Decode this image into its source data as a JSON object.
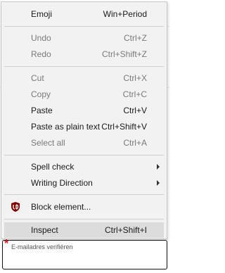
{
  "context_menu": {
    "items": [
      {
        "label": "Emoji",
        "shortcut": "Win+Period",
        "enabled": true
      },
      {
        "label": "Undo",
        "shortcut": "Ctrl+Z",
        "enabled": false
      },
      {
        "label": "Redo",
        "shortcut": "Ctrl+Shift+Z",
        "enabled": false
      },
      {
        "label": "Cut",
        "shortcut": "Ctrl+X",
        "enabled": false
      },
      {
        "label": "Copy",
        "shortcut": "Ctrl+C",
        "enabled": false
      },
      {
        "label": "Paste",
        "shortcut": "Ctrl+V",
        "enabled": true
      },
      {
        "label": "Paste as plain text",
        "shortcut": "Ctrl+Shift+V",
        "enabled": true
      },
      {
        "label": "Select all",
        "shortcut": "Ctrl+A",
        "enabled": false
      },
      {
        "label": "Spell check",
        "shortcut": "",
        "enabled": true,
        "submenu": true
      },
      {
        "label": "Writing Direction",
        "shortcut": "",
        "enabled": true,
        "submenu": true
      },
      {
        "label": "Block element...",
        "shortcut": "",
        "enabled": true,
        "icon": "ublock-origin-icon"
      },
      {
        "label": "Inspect",
        "shortcut": "Ctrl+Shift+I",
        "enabled": true,
        "highlighted": true
      }
    ]
  },
  "form": {
    "required_marker": "*",
    "field_placeholder": "E-mailadres verifiëren"
  },
  "colors": {
    "menu_background": "#f2f2f2",
    "highlight": "#dcdcdc",
    "disabled_text": "#7a7a7a",
    "required_red": "#e0152a",
    "ublock_red": "#800000"
  }
}
